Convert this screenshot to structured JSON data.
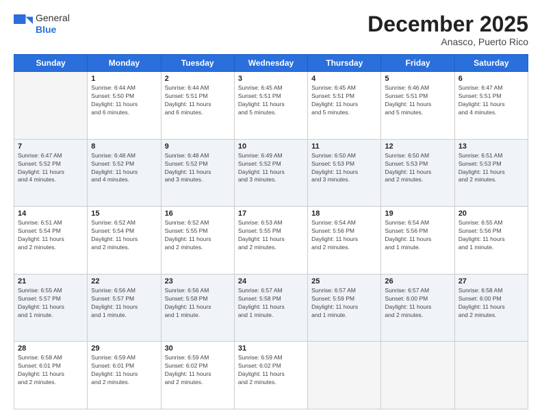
{
  "header": {
    "logo_general": "General",
    "logo_blue": "Blue",
    "month": "December 2025",
    "location": "Anasco, Puerto Rico"
  },
  "days_of_week": [
    "Sunday",
    "Monday",
    "Tuesday",
    "Wednesday",
    "Thursday",
    "Friday",
    "Saturday"
  ],
  "weeks": [
    [
      {
        "day": "",
        "info": ""
      },
      {
        "day": "1",
        "info": "Sunrise: 6:44 AM\nSunset: 5:50 PM\nDaylight: 11 hours\nand 6 minutes."
      },
      {
        "day": "2",
        "info": "Sunrise: 6:44 AM\nSunset: 5:51 PM\nDaylight: 11 hours\nand 6 minutes."
      },
      {
        "day": "3",
        "info": "Sunrise: 6:45 AM\nSunset: 5:51 PM\nDaylight: 11 hours\nand 5 minutes."
      },
      {
        "day": "4",
        "info": "Sunrise: 6:45 AM\nSunset: 5:51 PM\nDaylight: 11 hours\nand 5 minutes."
      },
      {
        "day": "5",
        "info": "Sunrise: 6:46 AM\nSunset: 5:51 PM\nDaylight: 11 hours\nand 5 minutes."
      },
      {
        "day": "6",
        "info": "Sunrise: 6:47 AM\nSunset: 5:51 PM\nDaylight: 11 hours\nand 4 minutes."
      }
    ],
    [
      {
        "day": "7",
        "info": "Sunrise: 6:47 AM\nSunset: 5:52 PM\nDaylight: 11 hours\nand 4 minutes."
      },
      {
        "day": "8",
        "info": "Sunrise: 6:48 AM\nSunset: 5:52 PM\nDaylight: 11 hours\nand 4 minutes."
      },
      {
        "day": "9",
        "info": "Sunrise: 6:48 AM\nSunset: 5:52 PM\nDaylight: 11 hours\nand 3 minutes."
      },
      {
        "day": "10",
        "info": "Sunrise: 6:49 AM\nSunset: 5:52 PM\nDaylight: 11 hours\nand 3 minutes."
      },
      {
        "day": "11",
        "info": "Sunrise: 6:50 AM\nSunset: 5:53 PM\nDaylight: 11 hours\nand 3 minutes."
      },
      {
        "day": "12",
        "info": "Sunrise: 6:50 AM\nSunset: 5:53 PM\nDaylight: 11 hours\nand 2 minutes."
      },
      {
        "day": "13",
        "info": "Sunrise: 6:51 AM\nSunset: 5:53 PM\nDaylight: 11 hours\nand 2 minutes."
      }
    ],
    [
      {
        "day": "14",
        "info": "Sunrise: 6:51 AM\nSunset: 5:54 PM\nDaylight: 11 hours\nand 2 minutes."
      },
      {
        "day": "15",
        "info": "Sunrise: 6:52 AM\nSunset: 5:54 PM\nDaylight: 11 hours\nand 2 minutes."
      },
      {
        "day": "16",
        "info": "Sunrise: 6:52 AM\nSunset: 5:55 PM\nDaylight: 11 hours\nand 2 minutes."
      },
      {
        "day": "17",
        "info": "Sunrise: 6:53 AM\nSunset: 5:55 PM\nDaylight: 11 hours\nand 2 minutes."
      },
      {
        "day": "18",
        "info": "Sunrise: 6:54 AM\nSunset: 5:56 PM\nDaylight: 11 hours\nand 2 minutes."
      },
      {
        "day": "19",
        "info": "Sunrise: 6:54 AM\nSunset: 5:56 PM\nDaylight: 11 hours\nand 1 minute."
      },
      {
        "day": "20",
        "info": "Sunrise: 6:55 AM\nSunset: 5:56 PM\nDaylight: 11 hours\nand 1 minute."
      }
    ],
    [
      {
        "day": "21",
        "info": "Sunrise: 6:55 AM\nSunset: 5:57 PM\nDaylight: 11 hours\nand 1 minute."
      },
      {
        "day": "22",
        "info": "Sunrise: 6:56 AM\nSunset: 5:57 PM\nDaylight: 11 hours\nand 1 minute."
      },
      {
        "day": "23",
        "info": "Sunrise: 6:56 AM\nSunset: 5:58 PM\nDaylight: 11 hours\nand 1 minute."
      },
      {
        "day": "24",
        "info": "Sunrise: 6:57 AM\nSunset: 5:58 PM\nDaylight: 11 hours\nand 1 minute."
      },
      {
        "day": "25",
        "info": "Sunrise: 6:57 AM\nSunset: 5:59 PM\nDaylight: 11 hours\nand 1 minute."
      },
      {
        "day": "26",
        "info": "Sunrise: 6:57 AM\nSunset: 6:00 PM\nDaylight: 11 hours\nand 2 minutes."
      },
      {
        "day": "27",
        "info": "Sunrise: 6:58 AM\nSunset: 6:00 PM\nDaylight: 11 hours\nand 2 minutes."
      }
    ],
    [
      {
        "day": "28",
        "info": "Sunrise: 6:58 AM\nSunset: 6:01 PM\nDaylight: 11 hours\nand 2 minutes."
      },
      {
        "day": "29",
        "info": "Sunrise: 6:59 AM\nSunset: 6:01 PM\nDaylight: 11 hours\nand 2 minutes."
      },
      {
        "day": "30",
        "info": "Sunrise: 6:59 AM\nSunset: 6:02 PM\nDaylight: 11 hours\nand 2 minutes."
      },
      {
        "day": "31",
        "info": "Sunrise: 6:59 AM\nSunset: 6:02 PM\nDaylight: 11 hours\nand 2 minutes."
      },
      {
        "day": "",
        "info": ""
      },
      {
        "day": "",
        "info": ""
      },
      {
        "day": "",
        "info": ""
      }
    ]
  ]
}
